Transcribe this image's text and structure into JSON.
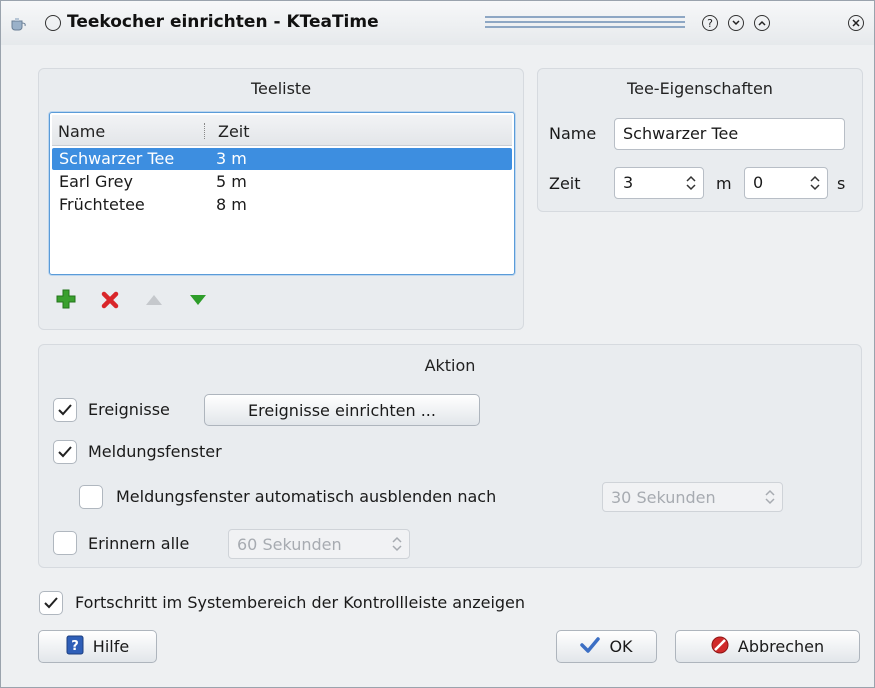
{
  "window": {
    "title": "Teekocher einrichten - KTeaTime"
  },
  "tea_list": {
    "title": "Teeliste",
    "columns": [
      "Name",
      "Zeit"
    ],
    "rows": [
      {
        "name": "Schwarzer Tee",
        "time": "3 m",
        "selected": true
      },
      {
        "name": "Earl Grey",
        "time": "5 m",
        "selected": false
      },
      {
        "name": "Früchtetee",
        "time": "8 m",
        "selected": false
      }
    ],
    "tools": [
      "add-icon",
      "remove-icon",
      "move-up-icon",
      "move-down-icon"
    ]
  },
  "properties": {
    "title": "Tee-Eigenschaften",
    "name_label": "Name",
    "name_value": "Schwarzer Tee",
    "time_label": "Zeit",
    "minutes_value": "3",
    "minutes_unit": "m",
    "seconds_value": "0",
    "seconds_unit": "s"
  },
  "action": {
    "title": "Aktion",
    "events_label": "Ereignisse",
    "events_checked": true,
    "events_button": "Ereignisse einrichten ...",
    "popup_label": "Meldungsfenster",
    "popup_checked": true,
    "autohide_label": "Meldungsfenster automatisch ausblenden nach",
    "autohide_checked": false,
    "autohide_value": "30 Sekunden",
    "remind_label": "Erinnern alle",
    "remind_checked": false,
    "remind_value": "60 Sekunden"
  },
  "progress_label": "Fortschritt im Systembereich der Kontrollleiste anzeigen",
  "progress_checked": true,
  "buttons": {
    "help": "Hilfe",
    "ok": "OK",
    "cancel": "Abbrechen"
  },
  "colors": {
    "selection": "#3d8ee0",
    "add": "#3aa02e",
    "remove": "#d9262a",
    "ok_check": "#3c6fc4",
    "cancel": "#d02a2a",
    "help": "#2f5fb8"
  }
}
